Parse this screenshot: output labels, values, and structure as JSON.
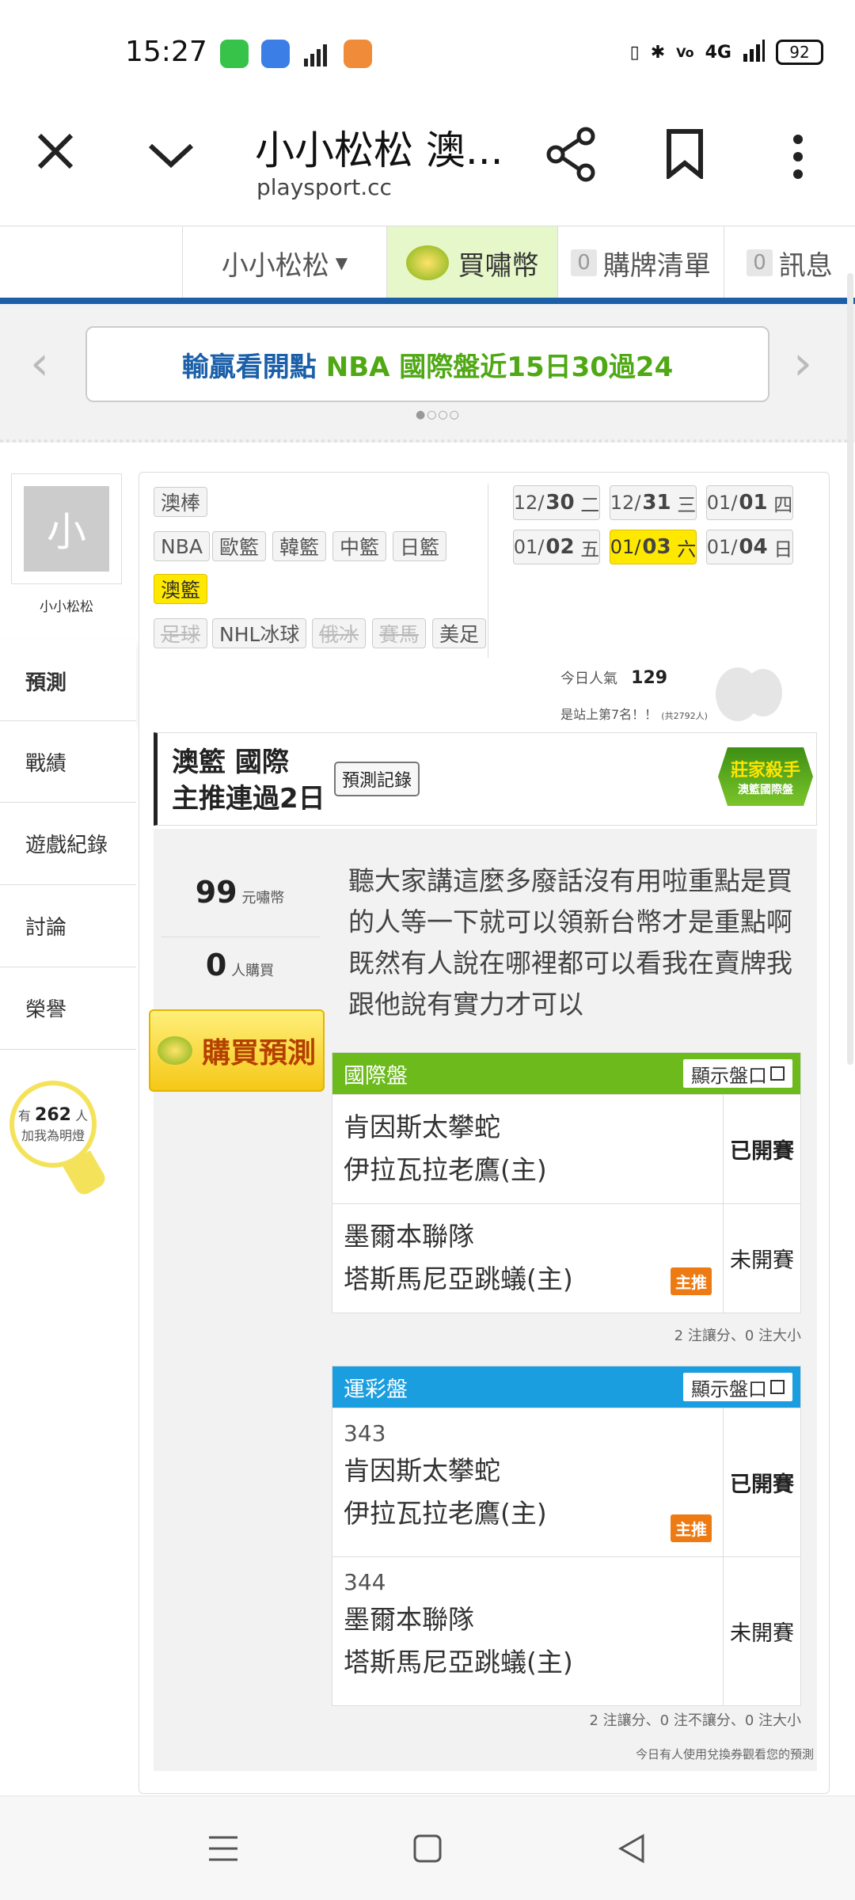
{
  "status_bar": {
    "time": "15:27",
    "battery": "92",
    "signal_text": "4G"
  },
  "browser": {
    "title": "小小松松 澳...",
    "url": "playsport.cc"
  },
  "site_nav": {
    "user": "小小松松",
    "buy_coins": "買嘯幣",
    "cart_count": "0",
    "cart_label": "購牌清單",
    "msg_count": "0",
    "msg_label": "訊息"
  },
  "banner": {
    "prefix": "輸贏看開點",
    "text": "NBA 國際盤近15日30過24"
  },
  "profile": {
    "avatar_letter": "小",
    "name": "小小松松"
  },
  "sidebar": {
    "items": [
      "預測",
      "戰績",
      "遊戲紀錄",
      "討論",
      "榮譽"
    ]
  },
  "fans": {
    "prefix": "有",
    "count": "262",
    "suffix": "人",
    "line2": "加我為明燈"
  },
  "leagues": {
    "row1": [
      "澳棒"
    ],
    "row2": [
      "NBA",
      "歐籃",
      "韓籃",
      "中籃",
      "日籃"
    ],
    "row3_selected": "澳籃",
    "row4": [
      "足球",
      "NHL冰球",
      "俄冰",
      "賽馬",
      "美足"
    ]
  },
  "dates": [
    {
      "md": "12/",
      "d": "30",
      "w": "二"
    },
    {
      "md": "12/",
      "d": "31",
      "w": "三"
    },
    {
      "md": "01/",
      "d": "01",
      "w": "四"
    },
    {
      "md": "01/",
      "d": "02",
      "w": "五"
    },
    {
      "md": "01/",
      "d": "03",
      "w": "六"
    },
    {
      "md": "01/",
      "d": "04",
      "w": "日"
    }
  ],
  "popularity": {
    "label": "今日人氣",
    "value": "129",
    "rank": "是站上第7名！！",
    "total": "(共2792人)"
  },
  "prediction": {
    "line1": "澳籃 國際",
    "line2": "主推連過2日",
    "record_button": "預測記錄",
    "badge_top": "莊家殺手",
    "badge_bottom": "澳籃國際盤",
    "price": "99",
    "price_unit": "元嘯幣",
    "buyers": "0",
    "buyers_unit": "人購買",
    "buy_button": "購買預測",
    "description": "聽大家講這麼多廢話沒有用啦重點是買的人等一下就可以領新台幣才是重點啊既然有人說在哪裡都可以看我在賣牌我跟他說有實力才可以"
  },
  "intl_table": {
    "header": "國際盤",
    "show_button": "顯示盤口",
    "rows": [
      {
        "team1": "肯因斯太攀蛇",
        "team2": "伊拉瓦拉老鷹(主)",
        "state": "已開賽"
      },
      {
        "team1": "墨爾本聯隊",
        "team2": "塔斯馬尼亞跳蟻(主)",
        "state": "未開賽",
        "tag": "主推"
      }
    ],
    "note": "2 注讓分、0 注大小"
  },
  "lottery_table": {
    "header": "運彩盤",
    "show_button": "顯示盤口",
    "rows": [
      {
        "num": "343",
        "team1": "肯因斯太攀蛇",
        "team2": "伊拉瓦拉老鷹(主)",
        "state": "已開賽",
        "tag": "主推"
      },
      {
        "num": "344",
        "team1": "墨爾本聯隊",
        "team2": "塔斯馬尼亞跳蟻(主)",
        "state": "未開賽"
      }
    ],
    "note": "2 注讓分、0 注不讓分、0 注大小"
  },
  "footer_note": "今日有人使用兌換券觀看您的預測",
  "colors": {
    "intl_header": "#6cba1c",
    "lottery_header": "#1a9ee0",
    "accent_blue": "#1a5fa8",
    "selected_yellow": "#ffe800"
  }
}
